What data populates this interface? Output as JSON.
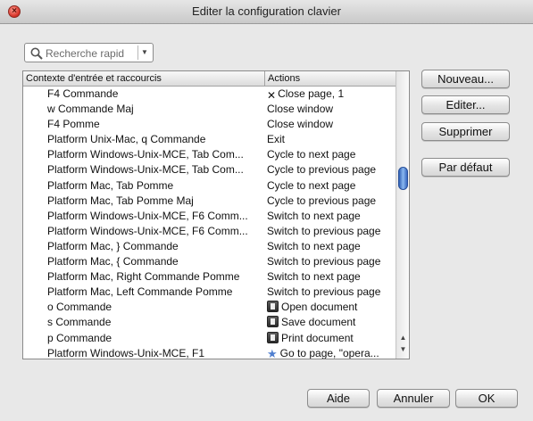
{
  "window": {
    "title": "Editer la configuration clavier"
  },
  "search": {
    "placeholder": "Recherche rapid"
  },
  "table": {
    "headers": [
      "Contexte d'entrée et raccourcis",
      "Actions"
    ],
    "rows": [
      {
        "shortcut": "F4 Commande",
        "action": "Close page, 1",
        "icon": "close-x-icon"
      },
      {
        "shortcut": "w Commande Maj",
        "action": "Close window",
        "icon": ""
      },
      {
        "shortcut": "F4 Pomme",
        "action": "Close window",
        "icon": ""
      },
      {
        "shortcut": "Platform Unix-Mac, q Commande",
        "action": "Exit",
        "icon": ""
      },
      {
        "shortcut": "Platform Windows-Unix-MCE, Tab Com...",
        "action": "Cycle to next page",
        "icon": ""
      },
      {
        "shortcut": "Platform Windows-Unix-MCE, Tab Com...",
        "action": "Cycle to previous page",
        "icon": ""
      },
      {
        "shortcut": "Platform Mac, Tab Pomme",
        "action": "Cycle to next page",
        "icon": ""
      },
      {
        "shortcut": "Platform Mac, Tab Pomme Maj",
        "action": "Cycle to previous page",
        "icon": ""
      },
      {
        "shortcut": "Platform Windows-Unix-MCE, F6 Comm...",
        "action": "Switch to next page",
        "icon": ""
      },
      {
        "shortcut": "Platform Windows-Unix-MCE, F6 Comm...",
        "action": "Switch to previous page",
        "icon": ""
      },
      {
        "shortcut": "Platform Mac, } Commande",
        "action": "Switch to next page",
        "icon": ""
      },
      {
        "shortcut": "Platform Mac, { Commande",
        "action": "Switch to previous page",
        "icon": ""
      },
      {
        "shortcut": "Platform Mac, Right Commande Pomme",
        "action": "Switch to next page",
        "icon": ""
      },
      {
        "shortcut": "Platform Mac, Left Commande Pomme",
        "action": "Switch to previous page",
        "icon": ""
      },
      {
        "shortcut": "o Commande",
        "action": "Open document",
        "icon": "open-document-icon"
      },
      {
        "shortcut": "s Commande",
        "action": "Save document",
        "icon": "save-document-icon"
      },
      {
        "shortcut": "p Commande",
        "action": "Print document",
        "icon": "print-document-icon"
      },
      {
        "shortcut": "Platform Windows-Unix-MCE, F1",
        "action": "Go to page, \"opera...",
        "icon": "star-icon"
      }
    ]
  },
  "side_buttons": {
    "new": "Nouveau...",
    "edit": "Editer...",
    "delete": "Supprimer",
    "default": "Par défaut"
  },
  "footer_buttons": {
    "help": "Aide",
    "cancel": "Annuler",
    "ok": "OK"
  },
  "colors": {
    "accent": "#3767c0",
    "window_bg": "#e8e8e8",
    "close_button": "#d8352a"
  }
}
